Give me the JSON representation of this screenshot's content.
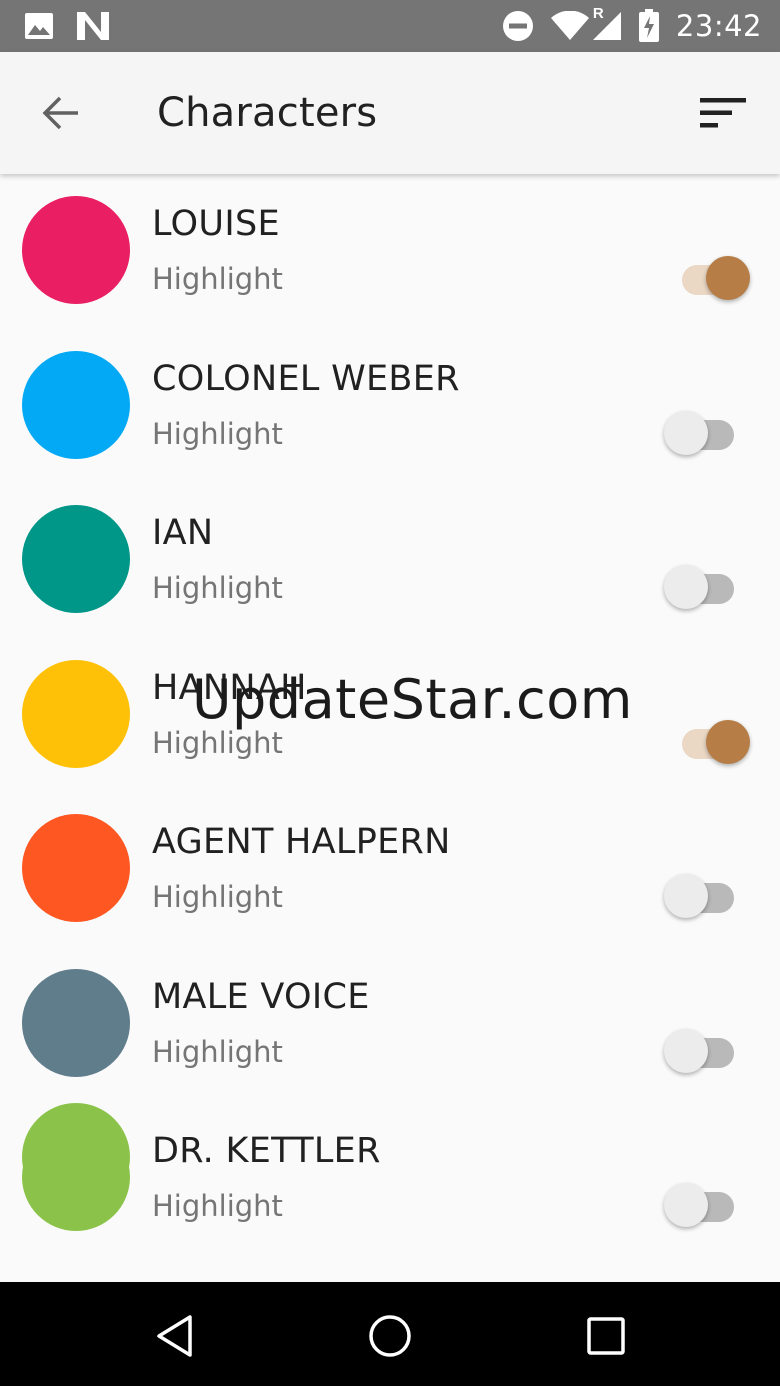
{
  "status_bar": {
    "time": "23:42",
    "icons": [
      "image-icon",
      "n-notification-icon",
      "do-not-disturb-icon",
      "wifi-icon",
      "signal-roaming-icon",
      "battery-charging-icon"
    ],
    "roaming_label": "R"
  },
  "app_bar": {
    "title": "Characters",
    "back_icon": "arrow-back-icon",
    "sort_icon": "sort-icon"
  },
  "characters": [
    {
      "name": "LOUISE",
      "subtitle": "Highlight",
      "color": "#e91e63",
      "highlight": true
    },
    {
      "name": "COLONEL WEBER",
      "subtitle": "Highlight",
      "color": "#03a9f4",
      "highlight": false
    },
    {
      "name": "IAN",
      "subtitle": "Highlight",
      "color": "#009688",
      "highlight": false
    },
    {
      "name": "HANNAH",
      "subtitle": "Highlight",
      "color": "#ffc107",
      "highlight": true
    },
    {
      "name": "AGENT HALPERN",
      "subtitle": "Highlight",
      "color": "#ff5722",
      "highlight": false
    },
    {
      "name": "MALE VOICE",
      "subtitle": "Highlight",
      "color": "#607d8b",
      "highlight": false
    },
    {
      "name": "DR. KETTLER",
      "subtitle": "Highlight",
      "color": "#8bc34a",
      "highlight": false
    }
  ],
  "peek_item": {
    "color": "#8bc34a"
  },
  "watermark": "UpdateStar.com",
  "nav_bar": {
    "icons": [
      "nav-back-icon",
      "nav-home-icon",
      "nav-recents-icon"
    ]
  }
}
